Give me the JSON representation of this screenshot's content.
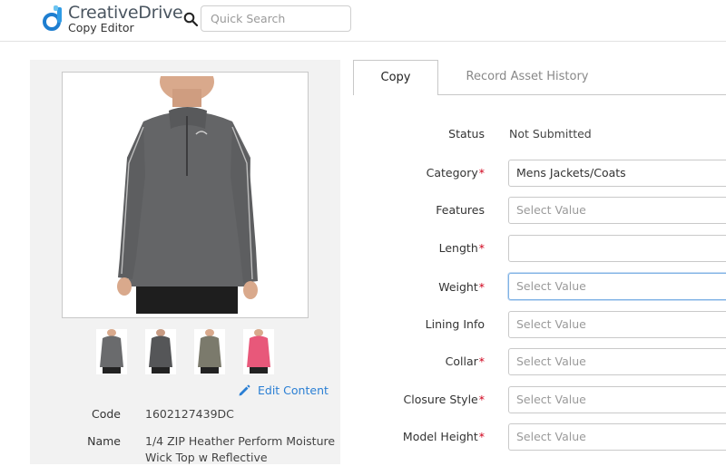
{
  "header": {
    "brand": "CreativeDrive",
    "subbrand": "Copy Editor",
    "search_placeholder": "Quick Search"
  },
  "product": {
    "edit_label": "Edit Content",
    "code_label": "Code",
    "code_value": "1602127439DC",
    "name_label": "Name",
    "name_value": "1/4 ZIP Heather Perform Moisture Wick Top w Reflective",
    "thumbnails": [
      "grey-front",
      "charcoal-back",
      "olive-front",
      "pink-front"
    ]
  },
  "tabs": [
    {
      "label": "Copy",
      "active": true
    },
    {
      "label": "Record Asset History",
      "active": false
    }
  ],
  "form": {
    "status_label": "Status",
    "status_value": "Not Submitted",
    "fields": [
      {
        "label": "Category",
        "required": true,
        "value": "Mens Jackets/Coats",
        "placeholder": ""
      },
      {
        "label": "Features",
        "required": false,
        "value": "",
        "placeholder": "Select Value"
      },
      {
        "label": "Length",
        "required": true,
        "value": "",
        "placeholder": ""
      },
      {
        "label": "Weight",
        "required": true,
        "value": "",
        "placeholder": "Select Value",
        "focused": true
      },
      {
        "label": "Lining Info",
        "required": false,
        "value": "",
        "placeholder": "Select Value"
      },
      {
        "label": "Collar",
        "required": true,
        "value": "",
        "placeholder": "Select Value"
      },
      {
        "label": "Closure Style",
        "required": true,
        "value": "",
        "placeholder": "Select Value"
      },
      {
        "label": "Model Height",
        "required": true,
        "value": "",
        "placeholder": "Select Value"
      }
    ],
    "required_marker": "*"
  },
  "colors": {
    "accent": "#2a7fd4",
    "required": "#d0021b",
    "panel_bg": "#f2f2f2",
    "focus_border": "#7fb2e5"
  }
}
